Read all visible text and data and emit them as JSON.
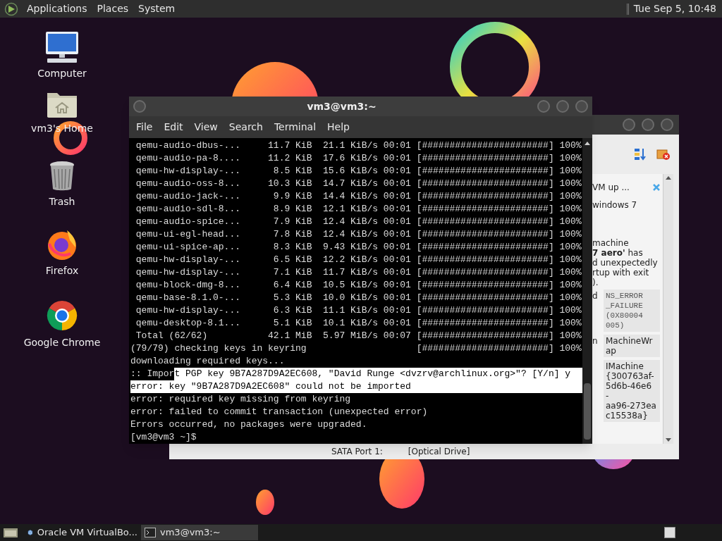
{
  "top_panel": {
    "menus": [
      "Applications",
      "Places",
      "System"
    ],
    "clock": "Tue Sep 5, 10:48"
  },
  "desktop_icons": [
    {
      "label": "Computer",
      "kind": "computer"
    },
    {
      "label": "vm3's Home",
      "kind": "home"
    },
    {
      "label": "Trash",
      "kind": "trash"
    },
    {
      "label": "Firefox",
      "kind": "firefox"
    },
    {
      "label": "Google Chrome",
      "kind": "chrome"
    }
  ],
  "background_window": {
    "notification": {
      "title": "VM up ...",
      "subtitle": "windows 7",
      "message_lines": [
        "machine",
        "**7 aero'** has",
        "d unexpectedly",
        "rtup with exit",
        ")."
      ],
      "details": [
        {
          "label": "d",
          "kind": "code",
          "value_lines": [
            "NS_ERROR",
            "_FAILURE",
            "(0X80004",
            "005)"
          ]
        },
        {
          "label": "n",
          "kind": "text",
          "value_lines": [
            "MachineWr",
            "ap"
          ]
        },
        {
          "kind": "text",
          "value_lines": [
            "IMachine",
            "{300763af-",
            "5d6b-46e6",
            "-",
            "aa96-273ea",
            "c15538a}"
          ]
        }
      ]
    },
    "storage": {
      "label": "SATA Port 1:",
      "value": "[Optical Drive]"
    }
  },
  "terminal": {
    "title": "vm3@vm3:~",
    "menu": [
      "File",
      "Edit",
      "View",
      "Search",
      "Terminal",
      "Help"
    ],
    "lines": [
      {
        "segments": [
          {
            "text": " qemu-audio-dbus-...     11.7 KiB  21.1 KiB/s 00:01 [#######################] 100%",
            "selected": false
          }
        ]
      },
      {
        "segments": [
          {
            "text": " qemu-audio-pa-8....     11.2 KiB  17.6 KiB/s 00:01 [#######################] 100%",
            "selected": false
          }
        ]
      },
      {
        "segments": [
          {
            "text": " qemu-hw-display-...      8.5 KiB  15.6 KiB/s 00:01 [#######################] 100%",
            "selected": false
          }
        ]
      },
      {
        "segments": [
          {
            "text": " qemu-audio-oss-8...     10.3 KiB  14.7 KiB/s 00:01 [#######################] 100%",
            "selected": false
          }
        ]
      },
      {
        "segments": [
          {
            "text": " qemu-audio-jack-...      9.9 KiB  14.4 KiB/s 00:01 [#######################] 100%",
            "selected": false
          }
        ]
      },
      {
        "segments": [
          {
            "text": " qemu-audio-sdl-8...      8.9 KiB  12.1 KiB/s 00:01 [#######################] 100%",
            "selected": false
          }
        ]
      },
      {
        "segments": [
          {
            "text": " qemu-audio-spice...      7.9 KiB  12.4 KiB/s 00:01 [#######################] 100%",
            "selected": false
          }
        ]
      },
      {
        "segments": [
          {
            "text": " qemu-ui-egl-head...      7.8 KiB  12.4 KiB/s 00:01 [#######################] 100%",
            "selected": false
          }
        ]
      },
      {
        "segments": [
          {
            "text": " qemu-ui-spice-ap...      8.3 KiB  9.43 KiB/s 00:01 [#######################] 100%",
            "selected": false
          }
        ]
      },
      {
        "segments": [
          {
            "text": " qemu-hw-display-...      6.5 KiB  12.2 KiB/s 00:01 [#######################] 100%",
            "selected": false
          }
        ]
      },
      {
        "segments": [
          {
            "text": " qemu-hw-display-...      7.1 KiB  11.7 KiB/s 00:01 [#######################] 100%",
            "selected": false
          }
        ]
      },
      {
        "segments": [
          {
            "text": " qemu-block-dmg-8...      6.4 KiB  10.5 KiB/s 00:01 [#######################] 100%",
            "selected": false
          }
        ]
      },
      {
        "segments": [
          {
            "text": " qemu-base-8.1.0-...      5.3 KiB  10.0 KiB/s 00:01 [#######################] 100%",
            "selected": false
          }
        ]
      },
      {
        "segments": [
          {
            "text": " qemu-hw-display-...      6.3 KiB  11.1 KiB/s 00:01 [#######################] 100%",
            "selected": false
          }
        ]
      },
      {
        "segments": [
          {
            "text": " qemu-desktop-8.1...      5.1 KiB  10.1 KiB/s 00:01 [#######################] 100%",
            "selected": false
          }
        ]
      },
      {
        "segments": [
          {
            "text": " Total (62/62)           42.1 MiB  5.97 MiB/s 00:07 [#######################] 100%",
            "selected": false
          }
        ]
      },
      {
        "segments": [
          {
            "text": "(79/79) checking keys in keyring                    [#######################] 100%",
            "selected": false
          }
        ]
      },
      {
        "segments": [
          {
            "text": "downloading required keys...",
            "selected": false
          }
        ]
      },
      {
        "segments": [
          {
            "text": ":: Impor",
            "selected": false
          },
          {
            "text": "t PGP key 9B7A287D9A2EC608, \"David Runge <dvzrv@archlinux.org>\"? [Y/n] y",
            "selected": true
          }
        ]
      },
      {
        "segments": [
          {
            "text": "error: key \"9B7A287D9A2EC608\" could not be imported",
            "selected": true
          }
        ]
      },
      {
        "segments": [
          {
            "text": "error: required key missing from keyring",
            "selected": false
          }
        ]
      },
      {
        "segments": [
          {
            "text": "error: failed to commit transaction (unexpected error)",
            "selected": false
          }
        ]
      },
      {
        "segments": [
          {
            "text": "Errors occurred, no packages were upgraded.",
            "selected": false
          }
        ]
      },
      {
        "segments": [
          {
            "text": "[vm3@vm3 ~]$",
            "selected": false
          }
        ]
      }
    ]
  },
  "taskbar": {
    "tasks": [
      {
        "label": "Oracle VM VirtualBo...",
        "kind": "virtualbox",
        "selected": false
      },
      {
        "label": "vm3@vm3:~",
        "kind": "terminal",
        "selected": true
      }
    ]
  }
}
